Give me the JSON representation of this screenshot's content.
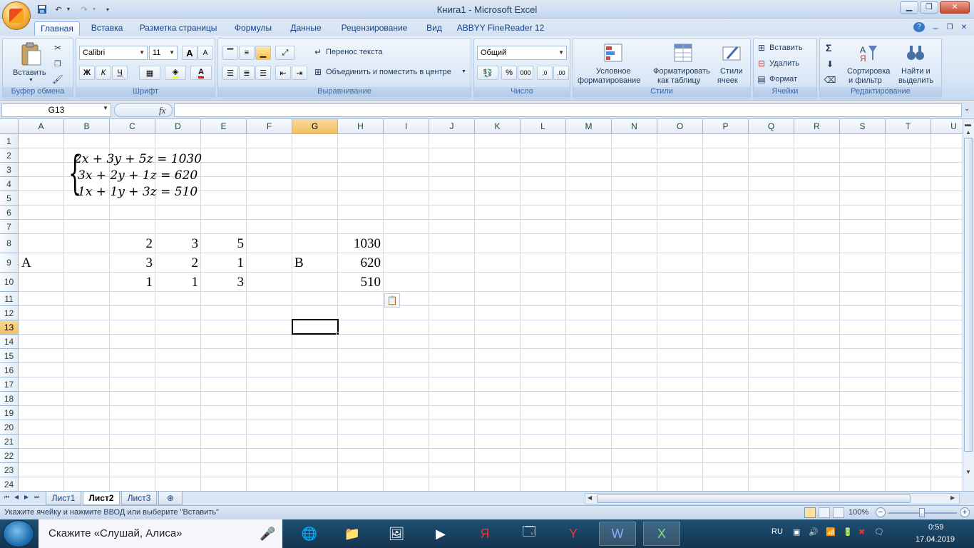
{
  "window": {
    "title": "Книга1 - Microsoft Excel",
    "min": "▁",
    "restore": "❐",
    "close": "✕",
    "doc_min": "–",
    "doc_restore": "❐",
    "doc_close": "✕",
    "help": "?"
  },
  "tabs": [
    "Главная",
    "Вставка",
    "Разметка страницы",
    "Формулы",
    "Данные",
    "Рецензирование",
    "Вид",
    "ABBYY FineReader 12"
  ],
  "ribbon": {
    "clipboard": {
      "label": "Буфер обмена",
      "paste": "Вставить"
    },
    "font": {
      "label": "Шрифт",
      "name": "Calibri",
      "size": "11",
      "bold": "Ж",
      "italic": "К",
      "underline": "Ч",
      "grow": "A",
      "shrink": "A",
      "color_letter": "A"
    },
    "alignment": {
      "label": "Выравнивание",
      "wrap": "Перенос текста",
      "merge": "Объединить и поместить в центре"
    },
    "number": {
      "label": "Число",
      "format": "Общий",
      "percent": "%",
      "thousands": "000",
      "inc": ",0",
      "dec": ",00"
    },
    "styles": {
      "label": "Стили",
      "conditional": "Условное",
      "conditional2": "форматирование",
      "table": "Форматировать",
      "table2": "как таблицу",
      "cell": "Стили",
      "cell2": "ячеек"
    },
    "cells": {
      "label": "Ячейки",
      "insert": "Вставить",
      "delete": "Удалить",
      "format": "Формат"
    },
    "editing": {
      "label": "Редактирование",
      "sort": "Сортировка",
      "sort2": "и фильтр",
      "find": "Найти и",
      "find2": "выделить",
      "sum": "Σ"
    }
  },
  "formula_bar": {
    "name_box": "G13",
    "fx": "fx",
    "value": ""
  },
  "columns": [
    "A",
    "B",
    "C",
    "D",
    "E",
    "F",
    "G",
    "H",
    "I",
    "J",
    "K",
    "L",
    "M",
    "N",
    "O",
    "P",
    "Q",
    "R",
    "S",
    "T",
    "U"
  ],
  "rows": [
    "1",
    "2",
    "3",
    "4",
    "5",
    "6",
    "7",
    "8",
    "9",
    "10",
    "11",
    "12",
    "13",
    "14",
    "15",
    "16",
    "17",
    "18",
    "19",
    "20",
    "21",
    "22",
    "23",
    "24"
  ],
  "selected_col": "G",
  "selected_row": "13",
  "equation": {
    "line1": "2x + 3y + 5z = 1030",
    "line2": "3x + 2y + 1z = 620",
    "line3": "1x + 1y + 3z = 510"
  },
  "cells": {
    "C8": "2",
    "D8": "3",
    "E8": "5",
    "H8": "1030",
    "A9": "A",
    "C9": "3",
    "D9": "2",
    "E9": "1",
    "G9": "B",
    "H9": "620",
    "C10": "1",
    "D10": "1",
    "E10": "3",
    "H10": "510"
  },
  "sheets": [
    "Лист1",
    "Лист2",
    "Лист3"
  ],
  "active_sheet": "Лист2",
  "status": {
    "message": "Укажите ячейку и нажмите ВВОД или выберите \"Вставить\"",
    "zoom": "100%"
  },
  "taskbar": {
    "search": "Скажите «Слушай, Алиса»",
    "lang": "RU",
    "time": "0:59",
    "date": "17.04.2019"
  }
}
